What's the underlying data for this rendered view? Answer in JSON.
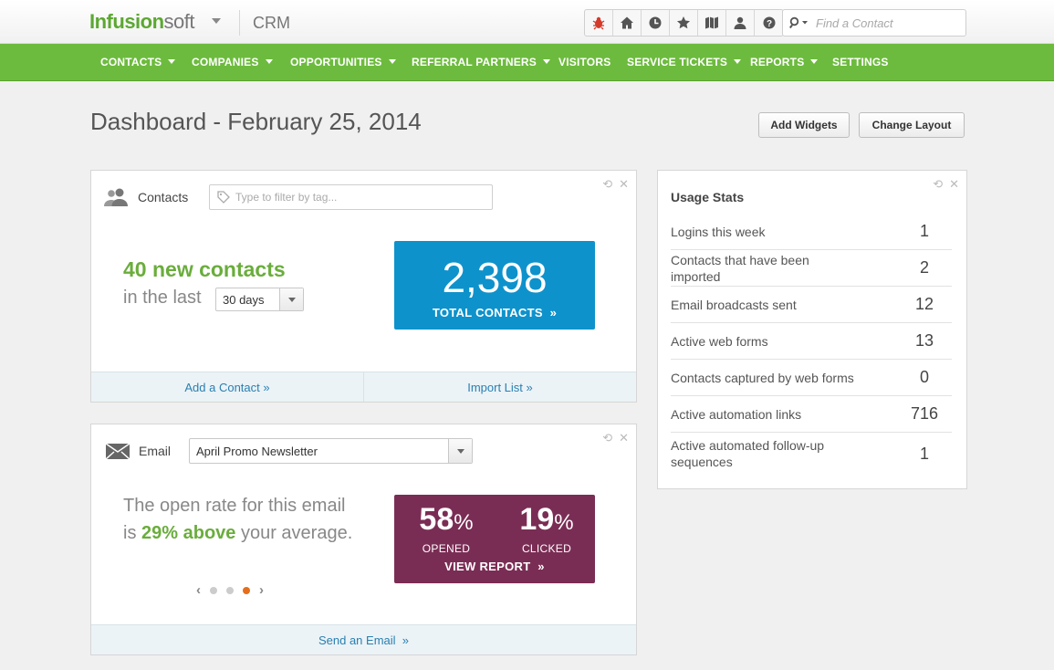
{
  "app": {
    "brand_part1": "Infusion",
    "brand_part2": "soft",
    "module": "CRM"
  },
  "topbar": {
    "icons": [
      "bug-icon",
      "home-icon",
      "recent-icon",
      "star-icon",
      "map-icon",
      "user-icon",
      "help-icon"
    ],
    "search_placeholder": "Find a Contact"
  },
  "nav": {
    "items": [
      {
        "label": "CONTACTS",
        "dropdown": true
      },
      {
        "label": "COMPANIES",
        "dropdown": true
      },
      {
        "label": "OPPORTUNITIES",
        "dropdown": true
      },
      {
        "label": "REFERRAL PARTNERS",
        "dropdown": true
      },
      {
        "label": "VISITORS",
        "dropdown": false
      },
      {
        "label": "SERVICE TICKETS",
        "dropdown": true
      },
      {
        "label": "REPORTS",
        "dropdown": true
      },
      {
        "label": "SETTINGS",
        "dropdown": false
      }
    ]
  },
  "page": {
    "title": "Dashboard - February 25, 2014",
    "add_widgets": "Add Widgets",
    "change_layout": "Change Layout"
  },
  "contacts_widget": {
    "label": "Contacts",
    "filter_placeholder": "Type to filter by tag...",
    "new_contacts": "40 new contacts",
    "in_the_last": "in the last",
    "period": "30 days",
    "total": "2,398",
    "total_label": "TOTAL CONTACTS",
    "add_contact": "Add a Contact",
    "import_list": "Import List"
  },
  "email_widget": {
    "label": "Email",
    "selected_email": "April Promo Newsletter",
    "text_before": "The open rate for this email is",
    "text_highlight": "29% above",
    "text_after": "your average.",
    "opened_value": "58",
    "opened_label": "OPENED",
    "clicked_value": "19",
    "clicked_label": "CLICKED",
    "percent": "%",
    "view_report": "VIEW REPORT",
    "carousel_active": 3,
    "send_email": "Send an Email"
  },
  "usage_stats": {
    "title": "Usage Stats",
    "rows": [
      {
        "label": "Logins this week",
        "value": "1"
      },
      {
        "label": "Contacts that have been imported",
        "value": "2"
      },
      {
        "label": "Email broadcasts sent",
        "value": "12"
      },
      {
        "label": "Active web forms",
        "value": "13"
      },
      {
        "label": "Contacts captured by web forms",
        "value": "0"
      },
      {
        "label": "Active automation links",
        "value": "716"
      },
      {
        "label": "Active automated follow-up sequences",
        "value": "1"
      }
    ]
  },
  "colors": {
    "nav_green": "#6dbb3e",
    "contacts_blue": "#0e92cc",
    "email_purple": "#7a2d54",
    "highlight_green": "#6aad3c",
    "active_dot": "#e36f1e"
  },
  "glyphs": {
    "chevrons": "»",
    "refresh": "⟲",
    "close": "✕",
    "prev": "‹",
    "next": "›"
  }
}
